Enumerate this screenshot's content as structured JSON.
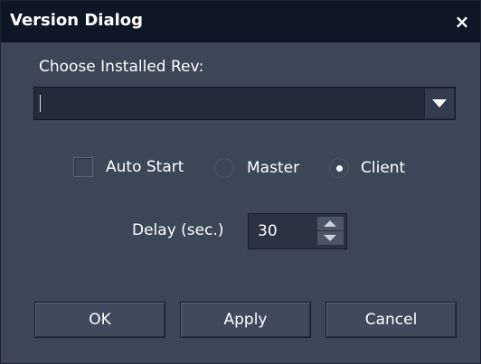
{
  "window": {
    "title": "Version Dialog",
    "close_glyph": "×"
  },
  "revision": {
    "label": "Choose Installed Rev:",
    "selected_value": ""
  },
  "options": {
    "auto_start_label": "Auto Start",
    "auto_start_checked": false,
    "mode_options": [
      {
        "label": "Master",
        "selected": false
      },
      {
        "label": "Client",
        "selected": true
      }
    ]
  },
  "delay": {
    "label": "Delay (sec.)",
    "value": "30"
  },
  "buttons": {
    "ok_label": "OK",
    "apply_label": "Apply",
    "cancel_label": "Cancel"
  },
  "colors": {
    "dialog_bg": "#3b4657",
    "titlebar_bg": "#0e1726",
    "input_bg": "#222b3a",
    "text": "#ffffff"
  },
  "icons": [
    "close-icon",
    "dropdown-arrow-icon",
    "spin-up-icon",
    "spin-down-icon"
  ]
}
